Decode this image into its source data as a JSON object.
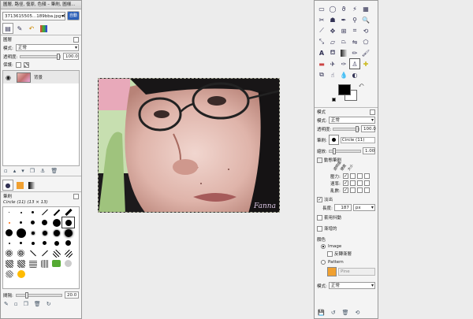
{
  "layers_dock": {
    "title": "圖層, 路徑, 復原, 色頻 – 筆刷, 圖樣...",
    "image_selector": "3713615505...189bba.jpg-4",
    "auto_button": "自動",
    "layers_label": "圖層",
    "mode_label": "模式:",
    "mode_value": "正常",
    "opacity_label": "透明度:",
    "opacity_value": "100.0",
    "lock_label": "保護:",
    "layer_name": "背景"
  },
  "brushes_panel": {
    "title": "筆刷",
    "current_brush": "Circle (11) (13 × 13)",
    "spacing_label": "間隔:",
    "spacing_value": "20.0"
  },
  "canvas": {
    "watermark": "Fanna"
  },
  "toolbox": {
    "options_title": "模式",
    "mode_label": "模式:",
    "mode_value": "正常",
    "opacity_label": "透明度:",
    "opacity_value": "100.0",
    "brush_label": "筆刷:",
    "brush_value": "Circle (11)",
    "scale_label": "縮放:",
    "scale_value": "1.00",
    "dynamics_label": "動態筆刷",
    "dyn_col_headers": [
      "透明度",
      "硬度",
      "大小"
    ],
    "dyn_rows": [
      "壓力:",
      "速率:",
      "亂數:"
    ],
    "fade_label": "淡出",
    "fade_length_label": "長度:",
    "fade_length_value": "187",
    "fade_unit": "px",
    "apply_jitter_label": "套用抖動",
    "incremental_label": "漸增的",
    "color_label": "顏色",
    "image_option": "Image",
    "reverse_label": "反轉漸層",
    "pattern_option": "Pattern",
    "pattern_name": "Pine",
    "bottom_mode_label": "模式:",
    "bottom_mode_value": "正常"
  },
  "colors": {
    "foreground": "#000000",
    "background": "#ffffff",
    "pattern_swatch": "#f0a030"
  }
}
